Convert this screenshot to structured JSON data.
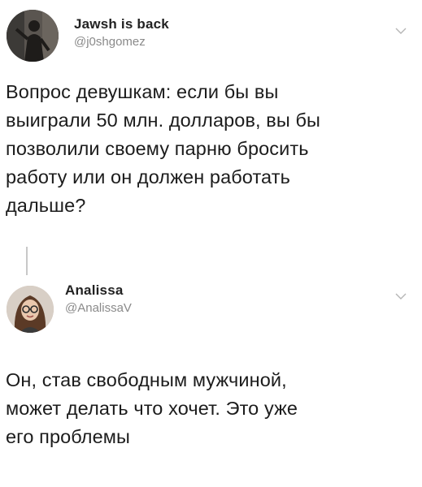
{
  "tweets": [
    {
      "author_name": "Jawsh is back",
      "author_handle": "@j0shgomez",
      "avatar_icon": "user-avatar-silhouette",
      "text_lines": [
        "Вопрос девушкам: если бы вы",
        "выиграли 50 млн. долларов, вы бы",
        "позволили своему парню бросить",
        "работу или он должен работать",
        "дальше?"
      ],
      "menu_icon": "chevron-down-icon"
    },
    {
      "author_name": "Analissa",
      "author_handle": "@AnalissaV",
      "avatar_icon": "user-avatar-photo",
      "text_lines": [
        "Он, став свободным мужчиной,",
        "может делать что хочет. Это уже",
        "его проблемы"
      ],
      "menu_icon": "chevron-down-icon"
    }
  ],
  "colors": {
    "background": "#ffffff",
    "text": "#1c1c1c",
    "handle": "#8a8a8a",
    "thread_line": "#c8c8c8"
  }
}
